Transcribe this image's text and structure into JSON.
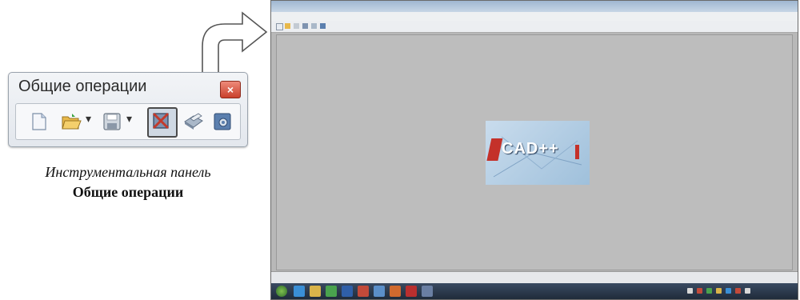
{
  "toolbar_window": {
    "title": "Общие операции",
    "close_symbol": "×",
    "buttons": [
      {
        "name": "new-document-icon"
      },
      {
        "name": "open-folder-icon"
      },
      {
        "name": "save-icon"
      },
      {
        "name": "select-frame-icon",
        "selected": true
      },
      {
        "name": "print-icon"
      },
      {
        "name": "settings-icon"
      }
    ],
    "dropdown_arrow": "▾"
  },
  "caption": {
    "line1": "Инструментальная панель",
    "line2": "Общие операции"
  },
  "app": {
    "splash_text": "CAD++",
    "colors": {
      "workspace": "#bdbdbd",
      "taskbar": "#25324a",
      "splash": "#b4cfe4"
    }
  }
}
